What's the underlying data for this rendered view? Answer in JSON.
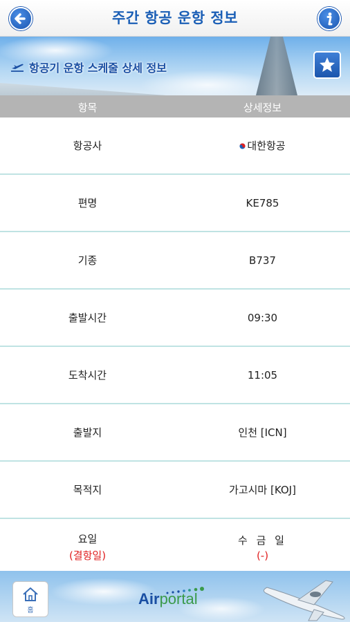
{
  "header": {
    "title": "주간 항공 운항 정보"
  },
  "banner": {
    "subtitle": "항공기 운항 스케줄 상세 정보"
  },
  "table": {
    "col_item": "항목",
    "col_detail": "상세정보",
    "rows": [
      {
        "label": "항공사",
        "value": "대한항공"
      },
      {
        "label": "편명",
        "value": "KE785"
      },
      {
        "label": "기종",
        "value": "B737"
      },
      {
        "label": "출발시간",
        "value": "09:30"
      },
      {
        "label": "도착시간",
        "value": "11:05"
      },
      {
        "label": "출발지",
        "value": "인천 [ICN]"
      },
      {
        "label": "목적지",
        "value": "가고시마 [KOJ]"
      },
      {
        "label": "요일",
        "sublabel": "(결항일)",
        "value": "수 금 일",
        "subvalue": "(-)"
      }
    ]
  },
  "footer": {
    "home_label": "홈",
    "logo_air": "Air",
    "logo_portal": "portal"
  },
  "icons": {
    "back": "arrow-left-icon",
    "info": "info-icon",
    "star": "star-icon",
    "plane": "airplane-takeoff-icon",
    "home": "home-icon"
  },
  "colors": {
    "accent": "#1b5fb6",
    "table_header": "#b4b4b4",
    "row_divider": "#bfe3e3",
    "warning": "#e02020"
  }
}
